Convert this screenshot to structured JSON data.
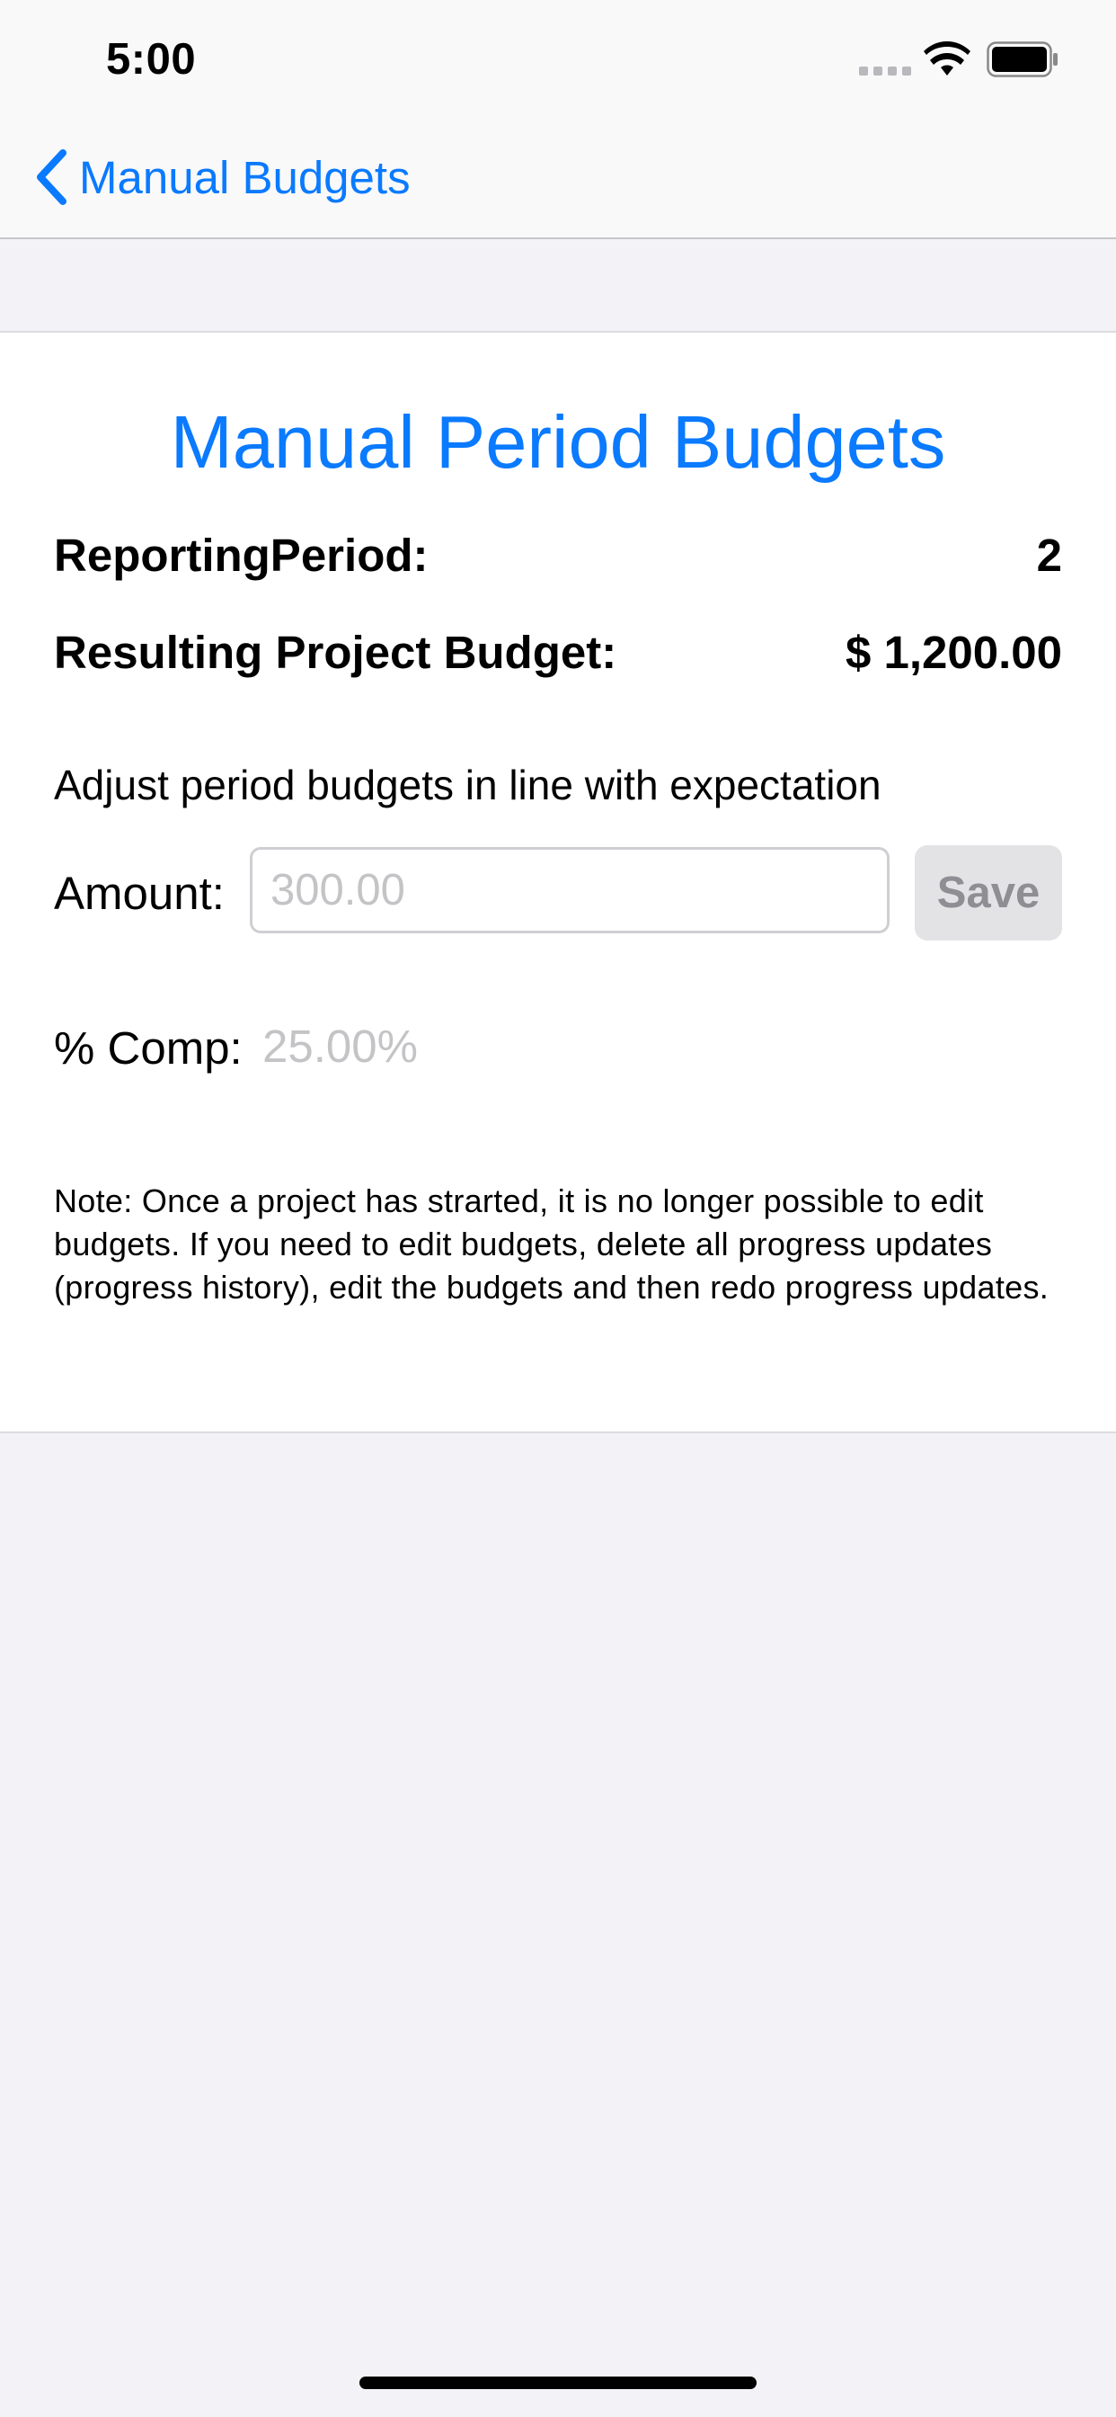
{
  "status_bar": {
    "time": "5:00"
  },
  "nav": {
    "back_label": "Manual Budgets"
  },
  "content": {
    "title": "Manual Period Budgets",
    "reporting_period_label": "ReportingPeriod:",
    "reporting_period_value": "2",
    "project_budget_label": "Resulting Project Budget:",
    "project_budget_value": "$ 1,200.00",
    "instruction": "Adjust period budgets in line with expectation",
    "amount_label": "Amount:",
    "amount_value": "",
    "amount_placeholder": "300.00",
    "save_label": "Save",
    "comp_label": "% Comp:",
    "comp_value": "25.00%",
    "note": "Note: Once a project has strarted, it is no longer possible to edit budgets. If you need to edit budgets, delete all progress updates (progress history), edit the budgets and then redo progress updates."
  },
  "colors": {
    "accent": "#0a7aff",
    "background": "#f2f2f7",
    "card": "#ffffff",
    "disabled_button": "#e3e3e6",
    "placeholder": "#c4c4c7"
  },
  "icons": {
    "back": "chevron-left-icon",
    "signal": "cellular-signal-icon",
    "wifi": "wifi-icon",
    "battery": "battery-icon"
  }
}
